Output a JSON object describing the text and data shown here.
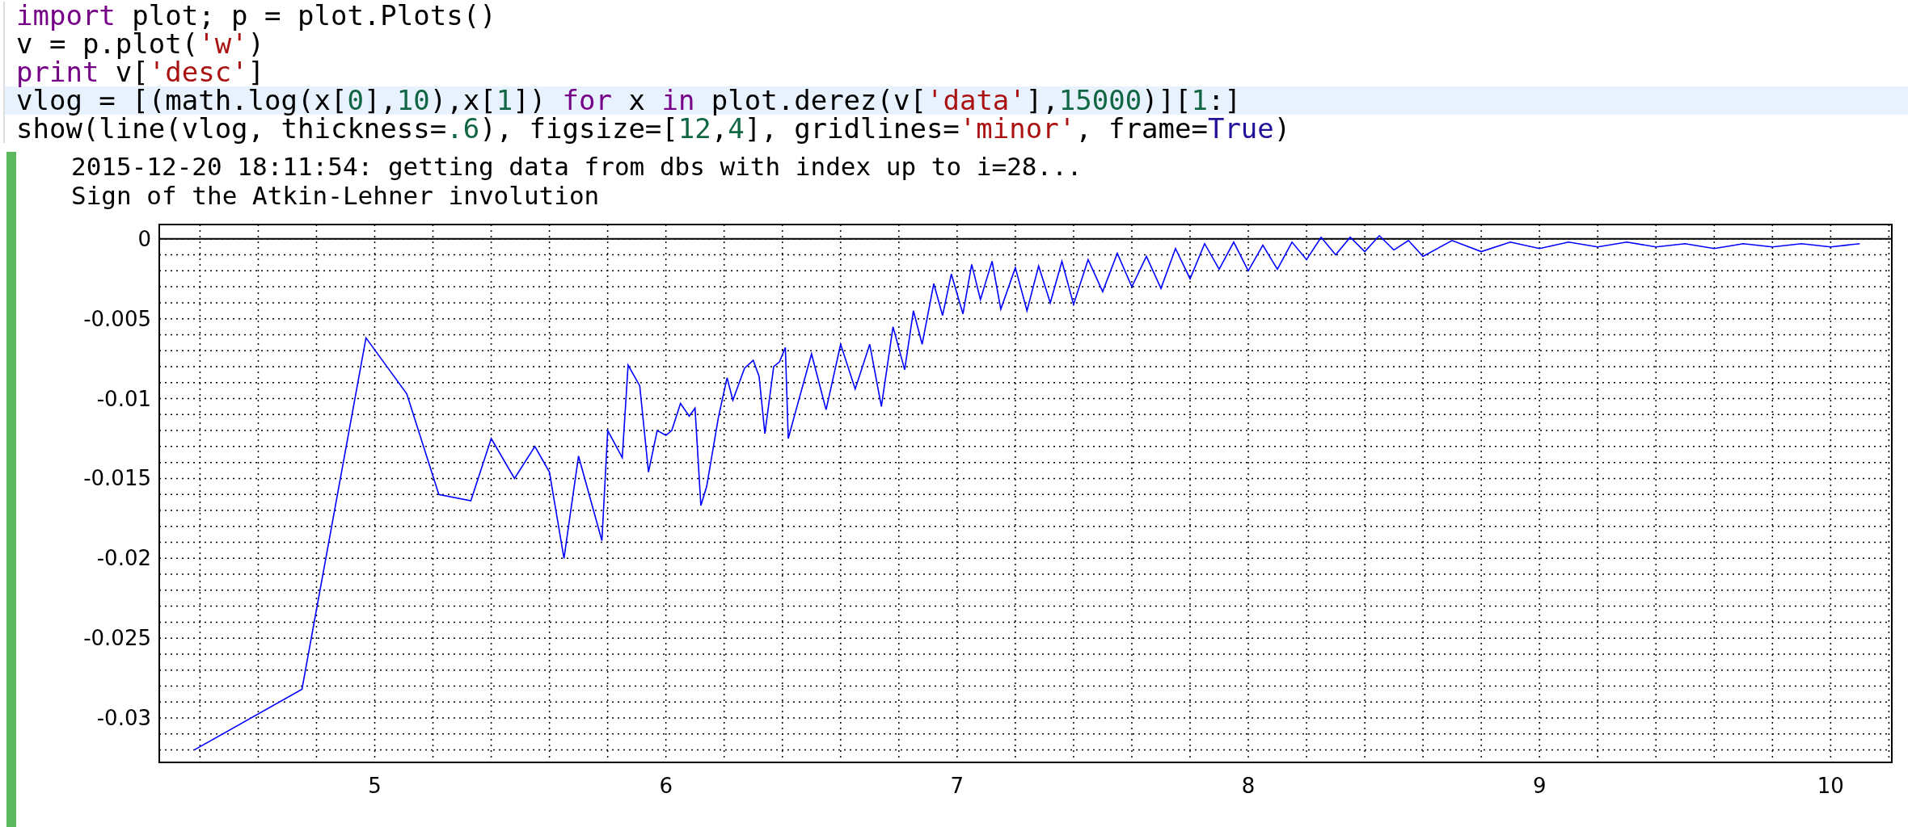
{
  "code_cell": {
    "lines": [
      {
        "highlighted": false,
        "tokens": [
          {
            "kind": "keyword",
            "text": "import"
          },
          {
            "kind": "plain",
            "text": " plot; p = plot.Plots()"
          }
        ]
      },
      {
        "highlighted": false,
        "tokens": [
          {
            "kind": "plain",
            "text": "v = p.plot("
          },
          {
            "kind": "string",
            "text": "'w'"
          },
          {
            "kind": "plain",
            "text": ")"
          }
        ]
      },
      {
        "highlighted": false,
        "tokens": [
          {
            "kind": "keyword",
            "text": "print"
          },
          {
            "kind": "plain",
            "text": " v["
          },
          {
            "kind": "string",
            "text": "'desc'"
          },
          {
            "kind": "plain",
            "text": "]"
          }
        ]
      },
      {
        "highlighted": true,
        "tokens": [
          {
            "kind": "plain",
            "text": "vlog = [(math.log(x["
          },
          {
            "kind": "number",
            "text": "0"
          },
          {
            "kind": "plain",
            "text": "],"
          },
          {
            "kind": "number",
            "text": "10"
          },
          {
            "kind": "plain",
            "text": "),x["
          },
          {
            "kind": "number",
            "text": "1"
          },
          {
            "kind": "plain",
            "text": "]) "
          },
          {
            "kind": "keyword",
            "text": "for"
          },
          {
            "kind": "plain",
            "text": " x "
          },
          {
            "kind": "keyword",
            "text": "in"
          },
          {
            "kind": "plain",
            "text": " plot.derez(v["
          },
          {
            "kind": "string",
            "text": "'data'"
          },
          {
            "kind": "plain",
            "text": "],"
          },
          {
            "kind": "number",
            "text": "15000"
          },
          {
            "kind": "plain",
            "text": ")]["
          },
          {
            "kind": "number",
            "text": "1"
          },
          {
            "kind": "plain",
            "text": ":]"
          }
        ]
      },
      {
        "highlighted": false,
        "tokens": [
          {
            "kind": "plain",
            "text": "show(line(vlog, thickness="
          },
          {
            "kind": "number",
            "text": ".6"
          },
          {
            "kind": "plain",
            "text": "), figsize=["
          },
          {
            "kind": "number",
            "text": "12"
          },
          {
            "kind": "plain",
            "text": ","
          },
          {
            "kind": "number",
            "text": "4"
          },
          {
            "kind": "plain",
            "text": "], gridlines="
          },
          {
            "kind": "string",
            "text": "'minor'"
          },
          {
            "kind": "plain",
            "text": ", frame="
          },
          {
            "kind": "atom",
            "text": "True"
          },
          {
            "kind": "plain",
            "text": ")"
          }
        ]
      }
    ]
  },
  "output": {
    "lines": [
      "2015-12-20 18:11:54: getting data from dbs with index up to i=28...",
      "Sign of the Atkin-Lehner involution"
    ],
    "chart_data": {
      "type": "line",
      "grid": "minor",
      "xlim": [
        4.26,
        10.21
      ],
      "ylim": [
        -0.03278,
        0.0009
      ],
      "xticks": [
        5,
        6,
        7,
        8,
        9,
        10
      ],
      "yticks": [
        {
          "value": 0,
          "label": "0"
        },
        {
          "value": -0.005,
          "label": "-0.005"
        },
        {
          "value": -0.01,
          "label": "-0.01"
        },
        {
          "value": -0.015,
          "label": "-0.015"
        },
        {
          "value": -0.02,
          "label": "-0.02"
        },
        {
          "value": -0.025,
          "label": "-0.025"
        },
        {
          "value": -0.03,
          "label": "-0.03"
        }
      ],
      "x": [
        4.38,
        4.75,
        4.97,
        5.11,
        5.22,
        5.33,
        5.4,
        5.48,
        5.55,
        5.6,
        5.65,
        5.7,
        5.78,
        5.8,
        5.85,
        5.87,
        5.91,
        5.94,
        5.97,
        6.0,
        6.02,
        6.05,
        6.08,
        6.1,
        6.12,
        6.14,
        6.18,
        6.21,
        6.23,
        6.27,
        6.3,
        6.32,
        6.34,
        6.37,
        6.39,
        6.41,
        6.42,
        6.45,
        6.5,
        6.55,
        6.6,
        6.65,
        6.7,
        6.74,
        6.78,
        6.82,
        6.85,
        6.88,
        6.92,
        6.95,
        6.98,
        7.02,
        7.05,
        7.08,
        7.12,
        7.15,
        7.2,
        7.24,
        7.28,
        7.32,
        7.36,
        7.4,
        7.45,
        7.5,
        7.55,
        7.6,
        7.65,
        7.7,
        7.75,
        7.8,
        7.85,
        7.9,
        7.95,
        8.0,
        8.05,
        8.1,
        8.15,
        8.2,
        8.25,
        8.3,
        8.35,
        8.4,
        8.45,
        8.5,
        8.55,
        8.6,
        8.7,
        8.8,
        8.9,
        9.0,
        9.1,
        9.2,
        9.3,
        9.4,
        9.5,
        9.6,
        9.7,
        9.8,
        9.9,
        10.0,
        10.1
      ],
      "series": [
        {
          "color": "#0000ff",
          "values": [
            -0.032,
            -0.0282,
            -0.0062,
            -0.0097,
            -0.016,
            -0.0164,
            -0.0125,
            -0.015,
            -0.013,
            -0.0146,
            -0.02,
            -0.0136,
            -0.0189,
            -0.012,
            -0.0137,
            -0.0079,
            -0.0092,
            -0.0146,
            -0.012,
            -0.0123,
            -0.012,
            -0.0103,
            -0.0111,
            -0.0106,
            -0.0167,
            -0.0155,
            -0.0112,
            -0.0087,
            -0.0101,
            -0.0081,
            -0.0076,
            -0.0086,
            -0.0122,
            -0.008,
            -0.0077,
            -0.0068,
            -0.0125,
            -0.0105,
            -0.0072,
            -0.0107,
            -0.0066,
            -0.0094,
            -0.0066,
            -0.0105,
            -0.0055,
            -0.0082,
            -0.0045,
            -0.0066,
            -0.0028,
            -0.0048,
            -0.0022,
            -0.0047,
            -0.0016,
            -0.0038,
            -0.0014,
            -0.0044,
            -0.0018,
            -0.0045,
            -0.0017,
            -0.004,
            -0.0014,
            -0.0041,
            -0.0013,
            -0.0033,
            -0.0009,
            -0.003,
            -0.0011,
            -0.0031,
            -0.0006,
            -0.0025,
            -0.0003,
            -0.0019,
            -0.0002,
            -0.002,
            -0.0004,
            -0.0019,
            -0.0002,
            -0.0013,
            0.0001,
            -0.001,
            0.0001,
            -0.0008,
            0.0002,
            -0.0007,
            -0.0001,
            -0.0011,
            -0.0001,
            -0.0008,
            -0.0002,
            -0.0006,
            -0.0002,
            -0.0005,
            -0.0002,
            -0.0005,
            -0.0003,
            -0.0006,
            -0.0003,
            -0.0005,
            -0.0003,
            -0.0005,
            -0.0003
          ]
        }
      ]
    }
  }
}
